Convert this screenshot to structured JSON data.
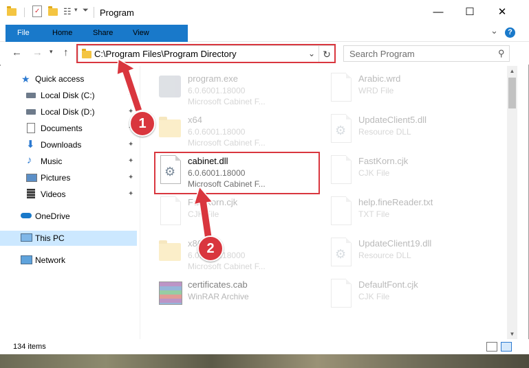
{
  "window": {
    "title": "Program",
    "controls": {
      "minimize": "—",
      "maximize": "☐",
      "close": "✕"
    }
  },
  "ribbon": {
    "tabs": [
      "File",
      "Home",
      "Share",
      "View"
    ],
    "collapse": "⌄",
    "help": "?"
  },
  "nav": {
    "back": "←",
    "forward": "→",
    "up": "↑",
    "address": "C:\\Program Files\\Program Directory",
    "dropdown": "⌄",
    "refresh": "↻",
    "search_placeholder": "Search Program",
    "search_icon": "⚲"
  },
  "sidebar": {
    "items": [
      {
        "label": "Quick access",
        "icon": "star-icon",
        "pinned": false
      },
      {
        "label": "Local Disk (C:)",
        "icon": "drive-icon",
        "pinned": true
      },
      {
        "label": "Local Disk (D:)",
        "icon": "drive-icon",
        "pinned": true
      },
      {
        "label": "Documents",
        "icon": "documents-icon",
        "pinned": true
      },
      {
        "label": "Downloads",
        "icon": "downloads-icon",
        "pinned": true
      },
      {
        "label": "Music",
        "icon": "music-icon",
        "pinned": true
      },
      {
        "label": "Pictures",
        "icon": "pictures-icon",
        "pinned": true
      },
      {
        "label": "Videos",
        "icon": "videos-icon",
        "pinned": true
      },
      {
        "label": "OneDrive",
        "icon": "onedrive-icon",
        "pinned": false
      },
      {
        "label": "This PC",
        "icon": "computer-icon",
        "pinned": false,
        "selected": true
      },
      {
        "label": "Network",
        "icon": "network-icon",
        "pinned": false
      }
    ],
    "pin_glyph": "📌"
  },
  "files": [
    {
      "name": "program.exe",
      "line2": "6.0.6001.18000",
      "line3": "Microsoft Cabinet F...",
      "icon": "exe-icon",
      "dim": true
    },
    {
      "name": "Arabic.wrd",
      "line2": "WRD File",
      "line3": "",
      "icon": "document-icon",
      "dim": true
    },
    {
      "name": "x64",
      "line2": "6.0.6001.18000",
      "line3": "Microsoft Cabinet F...",
      "icon": "folder-icon",
      "dim": true
    },
    {
      "name": "UpdateClient5.dll",
      "line2": "Resource DLL",
      "line3": "",
      "icon": "dll-icon",
      "dim": true
    },
    {
      "name": "cabinet.dll",
      "line2": "6.0.6001.18000",
      "line3": "Microsoft Cabinet F...",
      "icon": "dll-icon",
      "dim": false
    },
    {
      "name": "FastKorn.cjk",
      "line2": "CJK File",
      "line3": "",
      "icon": "document-icon",
      "dim": true
    },
    {
      "name": "FastKorn.cjk",
      "line2": "CJK File",
      "line3": "",
      "icon": "document-icon",
      "dim": true
    },
    {
      "name": "help.fineReader.txt",
      "line2": "TXT File",
      "line3": "",
      "icon": "document-icon",
      "dim": true
    },
    {
      "name": "x86",
      "line2": "6.0.6001.18000",
      "line3": "Microsoft Cabinet F...",
      "icon": "folder-icon",
      "dim": true
    },
    {
      "name": "UpdateClient19.dll",
      "line2": "Resource DLL",
      "line3": "",
      "icon": "dll-icon",
      "dim": true
    },
    {
      "name": "certificates.cab",
      "line2": "WinRAR Archive",
      "line3": "",
      "icon": "archive-icon",
      "dim": true
    },
    {
      "name": "DefaultFont.cjk",
      "line2": "CJK File",
      "line3": "",
      "icon": "document-icon",
      "dim": true
    }
  ],
  "status": {
    "item_count": "134 items"
  },
  "callouts": {
    "first": "1",
    "second": "2"
  },
  "colors": {
    "accent": "#1979ca",
    "highlight": "#d9363e",
    "selection": "#cce8ff"
  }
}
